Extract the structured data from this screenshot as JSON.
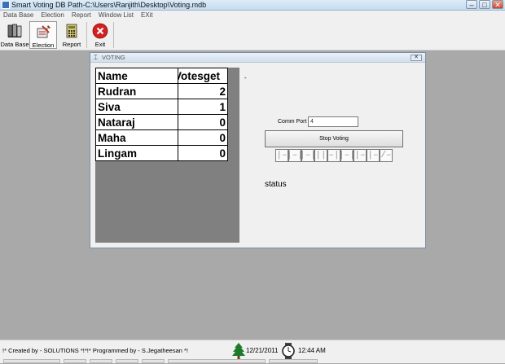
{
  "window": {
    "title": "Smart Voting  DB Path-C:\\Users\\Ranjith\\Desktop\\Voting.mdb",
    "controls": [
      "–",
      "□",
      "✕"
    ]
  },
  "menu": [
    "Data Base",
    "Election",
    "Report",
    "Window List",
    "EXit"
  ],
  "toolbar": {
    "database": "Data Base",
    "election": "Election",
    "report": "Report",
    "exit": "Exit"
  },
  "voting_window": {
    "title": "VOTING",
    "close": "✕",
    "dot": "-",
    "table": {
      "headers": [
        "Name",
        "Votesget"
      ],
      "rows": [
        {
          "name": "Rudran",
          "votes": "2"
        },
        {
          "name": "Siva",
          "votes": "1"
        },
        {
          "name": "Nataraj",
          "votes": "0"
        },
        {
          "name": "Maha",
          "votes": "0"
        },
        {
          "name": "Lingam",
          "votes": "0"
        }
      ]
    },
    "comm_port_label": "Comm Port",
    "comm_port_value": "4",
    "stop_button": "Stop Voting",
    "led_digits": [
      "|–",
      "|–|",
      "|–|",
      "||",
      "–|",
      "|–|",
      "|–",
      "|–",
      "/–"
    ],
    "status": "status"
  },
  "statusbar": {
    "credit": "!* Created by - SOLUTIONS *!*!* Programmed by - S.Jegatheesan *!",
    "date": "12/21/2011",
    "time": "12:44 AM"
  },
  "colors": {
    "mdi_background": "#a9a9a9",
    "grid_background": "#808080",
    "exit_red": "#d32020"
  }
}
